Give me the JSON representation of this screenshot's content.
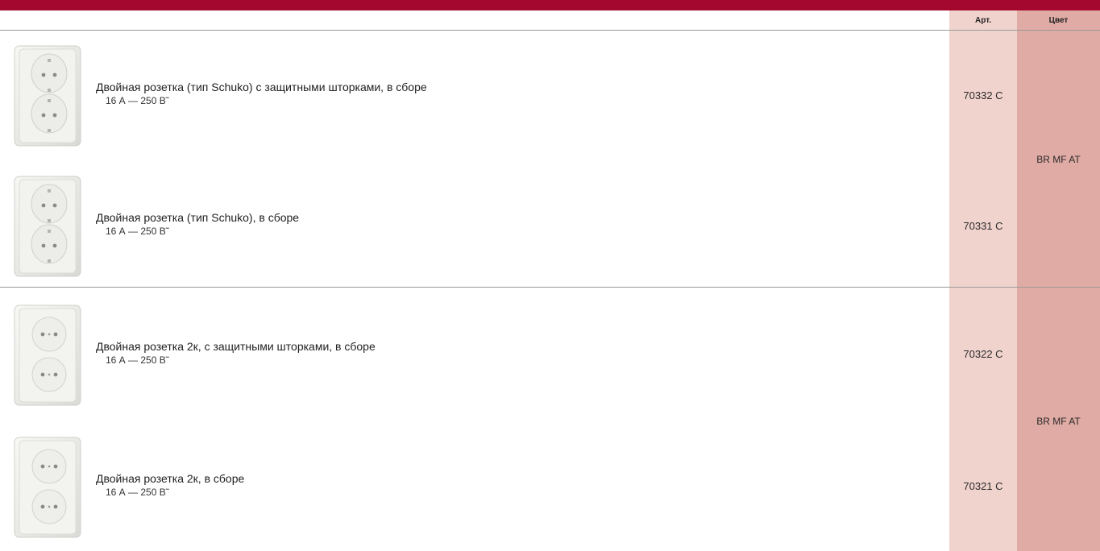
{
  "header": {
    "art_label": "Арт.",
    "color_label": "Цвет"
  },
  "products": [
    {
      "description": "Двойная розетка (тип Schuko) с защитными шторками, в сборе",
      "rating": "16 А — 250 В˜",
      "article": "70332 C",
      "image": "schuko-double-socket-icon"
    },
    {
      "description": "Двойная розетка (тип Schuko), в сборе",
      "rating": "16 А — 250 В˜",
      "article": "70331 C",
      "image": "schuko-double-socket-icon"
    },
    {
      "description": "Двойная розетка 2к, с защитными шторками, в сборе",
      "rating": "16 А — 250 В˜",
      "article": "70322 C",
      "image": "double-socket-2p-icon"
    },
    {
      "description": "Двойная розетка 2к, в сборе",
      "rating": "16 А — 250 В˜",
      "article": "70321 C",
      "image": "double-socket-2p-icon"
    }
  ],
  "groups": [
    {
      "color": "BR MF AT"
    },
    {
      "color": "BR MF AT"
    }
  ],
  "colors": {
    "brand_bar": "#a5082f",
    "art_column": "#f1d3ce",
    "color_column": "#e0aba4"
  }
}
